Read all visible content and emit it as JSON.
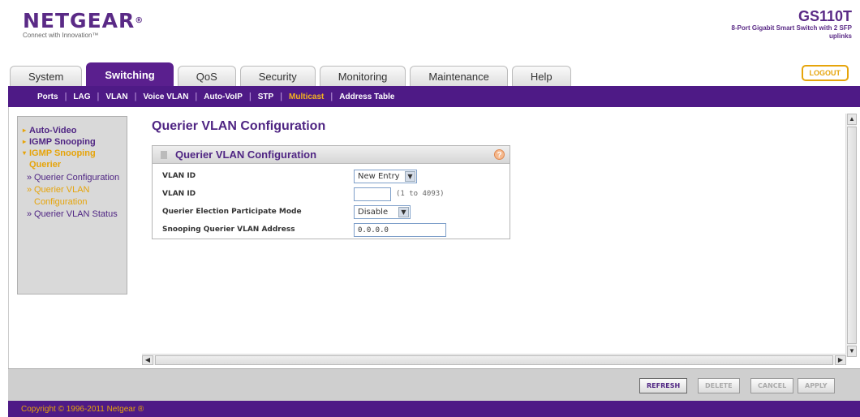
{
  "header": {
    "brand": "NETGEAR",
    "brand_mark": "®",
    "tagline": "Connect with Innovation™",
    "model": "GS110T",
    "description": "8-Port Gigabit Smart Switch with 2 SFP uplinks",
    "logout_label": "LOGOUT"
  },
  "tabs": [
    "System",
    "Switching",
    "QoS",
    "Security",
    "Monitoring",
    "Maintenance",
    "Help"
  ],
  "active_tab": "Switching",
  "subnav": [
    "Ports",
    "LAG",
    "VLAN",
    "Voice VLAN",
    "Auto-VoIP",
    "STP",
    "Multicast",
    "Address Table"
  ],
  "active_subnav": "Multicast",
  "leftnav": {
    "auto_video": "Auto-Video",
    "igmp_snooping": "IGMP Snooping",
    "igmp_snooping_querier": "IGMP Snooping Querier",
    "items": [
      "Querier Configuration",
      "Querier VLAN Configuration",
      "Querier VLAN Status"
    ]
  },
  "main": {
    "title": "Querier VLAN Configuration",
    "panel_title": "Querier VLAN Configuration",
    "help_symbol": "?",
    "rows": {
      "vlan_id_select_label": "VLAN ID",
      "vlan_id_select_value": "New Entry",
      "vlan_id_input_label": "VLAN ID",
      "vlan_id_input_value": "",
      "vlan_id_range": "(1 to 4093)",
      "mode_label": "Querier Election Participate Mode",
      "mode_value": "Disable",
      "address_label": "Snooping Querier VLAN Address",
      "address_value": "0.0.0.0"
    }
  },
  "buttons": {
    "refresh": "REFRESH",
    "delete": "DELETE",
    "cancel": "CANCEL",
    "apply": "APPLY"
  },
  "footer": {
    "copyright": "Copyright © 1996-2011 Netgear ®"
  },
  "colors": {
    "brand_purple": "#4e1a86",
    "accent_orange": "#e6a40a"
  },
  "icons": {
    "help": "help-icon",
    "dropdown": "chevron-down-icon",
    "nav_caret": "caret-right-icon"
  }
}
